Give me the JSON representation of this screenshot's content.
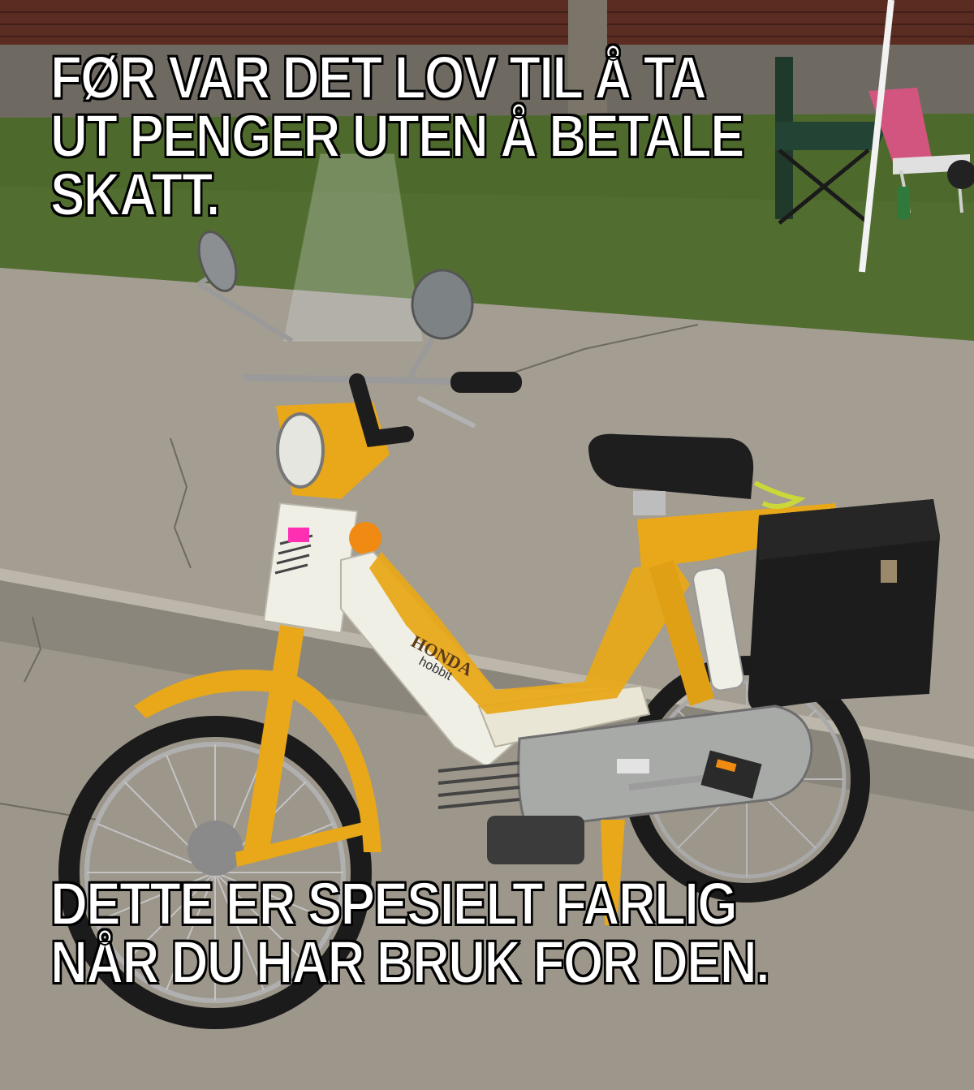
{
  "meme": {
    "top_lines": [
      "FØR VAR DET LOV TIL Å TA",
      "UT PENGER UTEN Å BETALE",
      "SKATT."
    ],
    "bottom_lines": [
      "DETTE ER SPESIELT FARLIG",
      "NÅR DU HAR BRUK FOR DEN."
    ]
  },
  "photo": {
    "subject": "yellow-white-moped",
    "brand_label": "HONDA",
    "icons": [
      "moped-image"
    ],
    "colors": {
      "body_yellow": "#e8a81a",
      "body_white": "#f0efe6",
      "pavement": "#a39d92",
      "grass": "#4d6a2c",
      "brick": "#5a2c22"
    }
  }
}
